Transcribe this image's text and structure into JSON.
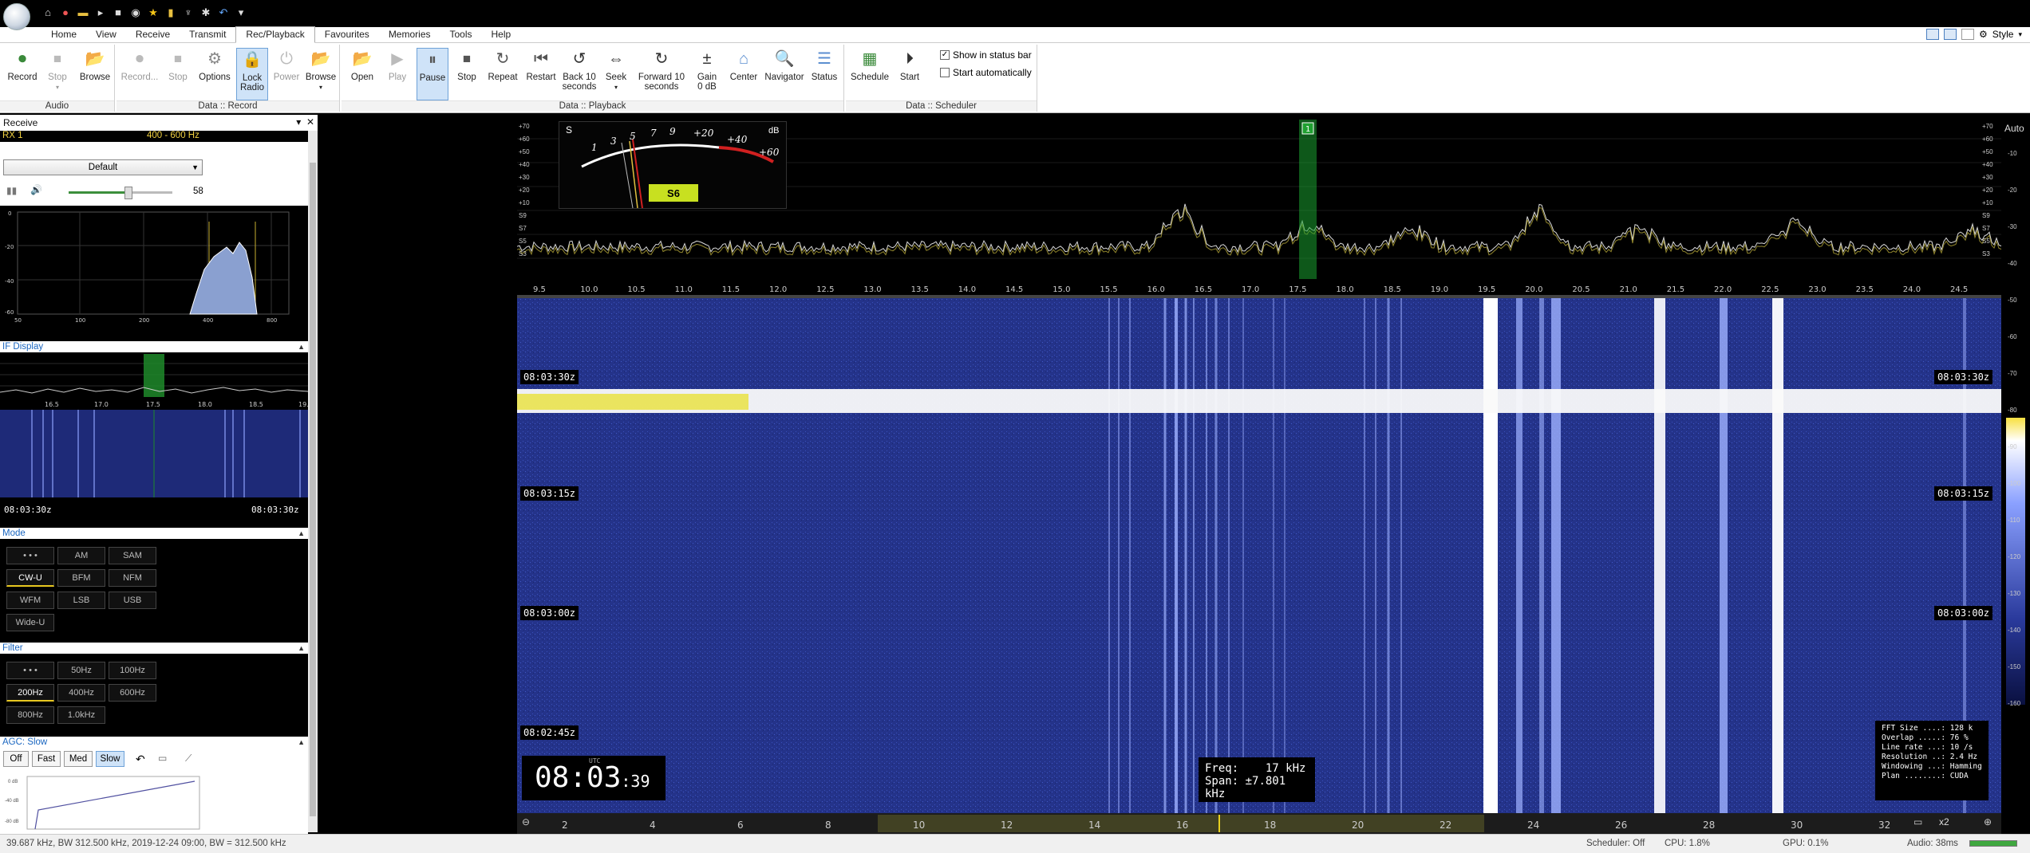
{
  "ribbon_tabs": [
    "Home",
    "View",
    "Receive",
    "Transmit",
    "Rec/Playback",
    "Favourites",
    "Memories",
    "Tools",
    "Help"
  ],
  "style_label": "Style",
  "groups": {
    "audio": {
      "label": "Audio",
      "record": "Record",
      "stop": "Stop",
      "browse": "Browse"
    },
    "data_record": {
      "label": "Data :: Record",
      "record": "Record...",
      "stop": "Stop",
      "options": "Options",
      "lock": "Lock",
      "radio": "Radio",
      "power": "Power",
      "browse": "Browse"
    },
    "data_playback": {
      "label": "Data :: Playback",
      "open": "Open",
      "play": "Play",
      "pause": "Pause",
      "stop": "Stop",
      "repeat": "Repeat",
      "restart": "Restart",
      "back": "Back 10",
      "back2": "seconds",
      "seek": "Seek",
      "forward": "Forward 10",
      "forward2": "seconds",
      "gain": "Gain",
      "gain2": "0 dB",
      "center": "Center",
      "navigator": "Navigator",
      "status": "Status"
    },
    "data_scheduler": {
      "label": "Data :: Scheduler",
      "schedule": "Schedule",
      "start": "Start",
      "show_status": "Show in status bar",
      "start_auto": "Start automatically"
    }
  },
  "left": {
    "receive_title": "Receive",
    "rx_name": "RX 1",
    "rx_bw": "400 - 600 Hz",
    "preset": "Default",
    "volume": 58,
    "volume_fraction": 0.58,
    "af_ticks_y": [
      "0",
      "-20",
      "-40",
      "-60"
    ],
    "af_ticks_x": [
      "50",
      "100",
      "200",
      "400",
      "800"
    ],
    "if_title": "IF Display",
    "if_ticks": [
      "16.5",
      "17.0",
      "17.5",
      "18.0",
      "18.5",
      "19.0"
    ],
    "if_time_left": "08:03:30z",
    "if_time_right": "08:03:30z",
    "mode_title": "Mode",
    "modes": [
      "• • •",
      "AM",
      "SAM",
      "CW-U",
      "BFM",
      "NFM",
      "WFM",
      "LSB",
      "USB",
      "Wide-U"
    ],
    "filter_title": "Filter",
    "filters": [
      "• • •",
      "50Hz",
      "100Hz",
      "200Hz",
      "400Hz",
      "600Hz",
      "800Hz",
      "1.0kHz"
    ],
    "agc_title": "AGC: Slow",
    "agc": [
      "Off",
      "Fast",
      "Med",
      "Slow"
    ],
    "agc_ticks": [
      "0 dB",
      "-40 dB",
      "-80 dB"
    ]
  },
  "spectrum": {
    "db_ticks": [
      "+70",
      "+60",
      "+50",
      "+40",
      "+30",
      "+20",
      "+10",
      "S9",
      "S7",
      "S5",
      "S3"
    ],
    "freq_ticks": [
      "9.5",
      "10.0",
      "10.5",
      "11.0",
      "11.5",
      "12.0",
      "12.5",
      "13.0",
      "13.5",
      "14.0",
      "14.5",
      "15.0",
      "15.5",
      "16.0",
      "16.5",
      "17.0",
      "17.5",
      "18.0",
      "18.5",
      "19.0",
      "19.5",
      "20.0",
      "20.5",
      "21.0",
      "21.5",
      "22.0",
      "22.5",
      "23.0",
      "23.5",
      "24.0",
      "24.5"
    ],
    "vfo_label": "1",
    "smeter_s": "S",
    "smeter_db": "dB",
    "smeter_scale": [
      "1",
      "3",
      "5",
      "7",
      "9",
      "+20",
      "+40",
      "+60"
    ],
    "smeter_reading": "S6",
    "auto": "Auto"
  },
  "waterfall": {
    "time_labels": [
      "08:03:30z",
      "08:03:15z",
      "08:03:00z",
      "08:02:45z"
    ],
    "clock_hm": "08:03",
    "clock_ss": ":39",
    "clock_utc": "UTC",
    "freq_label": "Freq:",
    "freq_value": "17 kHz",
    "span_label": "Span:",
    "span_value": "±7.801 kHz",
    "fft": [
      "FFT Size ....: 128 k",
      "Overlap .....: 76 %",
      "Line rate ...: 10 /s",
      "Resolution ..: 2.4 Hz",
      "Windowing ...: Hamming",
      "Plan ........: CUDA"
    ],
    "nav_ticks": [
      "2",
      "4",
      "6",
      "8",
      "10",
      "12",
      "14",
      "16",
      "18",
      "20",
      "22",
      "24",
      "26",
      "28",
      "30",
      "32"
    ],
    "nav_zoom": "x2",
    "scale_ticks": [
      "-10",
      "-20",
      "-30",
      "-40",
      "-50",
      "-60",
      "-70",
      "-80",
      "-90",
      "-100",
      "-110",
      "-120",
      "-130",
      "-140",
      "-150",
      "-160"
    ]
  },
  "status": {
    "left": "39.687 kHz, BW 312.500 kHz, 2019-12-24 09:00, BW = 312.500 kHz",
    "scheduler": "Scheduler: Off",
    "cpu": "CPU: 1.8%",
    "gpu": "GPU: 0.1%",
    "audio": "Audio: 38ms"
  },
  "colors": {
    "accent": "#1a66c0",
    "waterfall_bg": "#2a3a8c",
    "vfo_green": "#22c040",
    "sbadge": "#c8e020"
  }
}
